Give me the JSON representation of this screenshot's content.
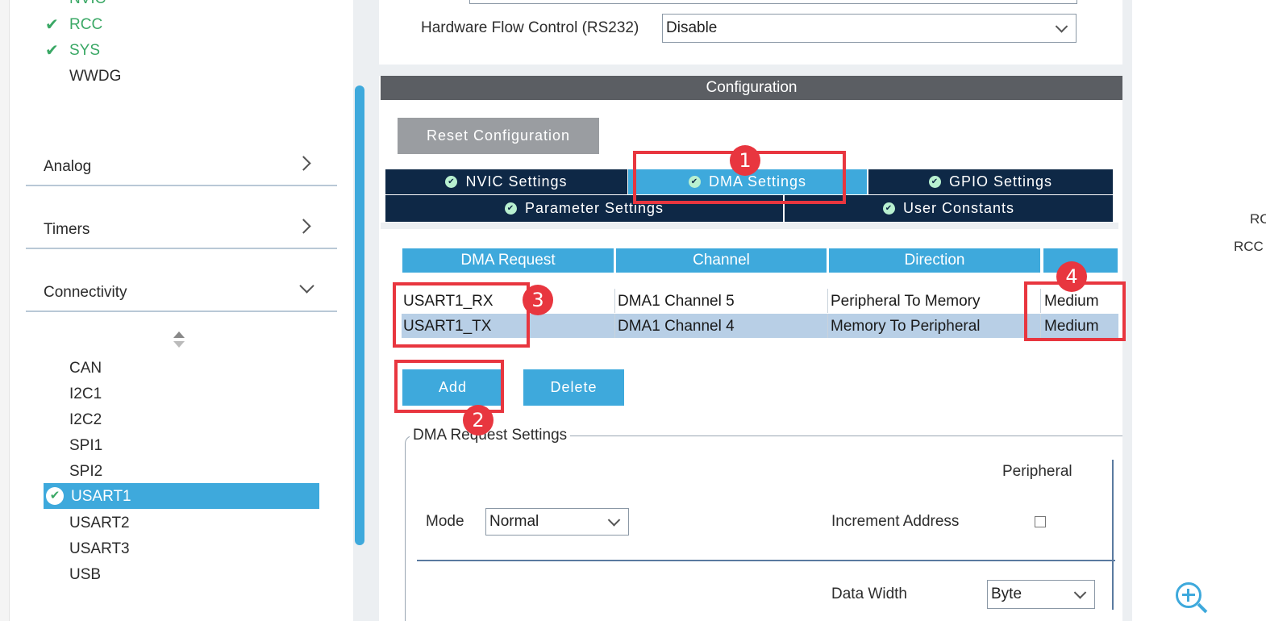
{
  "sidebar": {
    "partial_top": "NVIC",
    "system_items": [
      {
        "label": "RCC",
        "checked": true
      },
      {
        "label": "SYS",
        "checked": true
      },
      {
        "label": "WWDG",
        "checked": false
      }
    ],
    "categories": [
      {
        "label": "Analog",
        "chevron": "chevron-right-icon"
      },
      {
        "label": "Timers",
        "chevron": "chevron-right-icon"
      },
      {
        "label": "Connectivity",
        "chevron": "chevron-down-icon"
      }
    ],
    "connectivity_items": [
      "CAN",
      "I2C1",
      "I2C2",
      "SPI1",
      "SPI2",
      "USART1",
      "USART2",
      "USART3",
      "USB"
    ],
    "selected_item": "USART1"
  },
  "top_form": {
    "flow_control_label": "Hardware Flow Control (RS232)",
    "flow_control_value": "Disable"
  },
  "config": {
    "title": "Configuration",
    "reset_button": "Reset Configuration",
    "tabs_row1": [
      {
        "label": "NVIC Settings",
        "active": false
      },
      {
        "label": "DMA Settings",
        "active": true
      },
      {
        "label": "GPIO Settings",
        "active": false
      }
    ],
    "tabs_row2": [
      {
        "label": "Parameter Settings"
      },
      {
        "label": "User Constants"
      }
    ]
  },
  "dma_table": {
    "headers": [
      "DMA Request",
      "Channel",
      "Direction",
      ""
    ],
    "rows": [
      {
        "request": "USART1_RX",
        "channel": "DMA1 Channel 5",
        "direction": "Peripheral To Memory",
        "priority": "Medium",
        "selected": false
      },
      {
        "request": "USART1_TX",
        "channel": "DMA1 Channel 4",
        "direction": "Memory To Peripheral",
        "priority": "Medium",
        "selected": true
      }
    ],
    "add_button": "Add",
    "delete_button": "Delete"
  },
  "request_settings": {
    "legend": "DMA Request Settings",
    "peripheral_heading": "Peripheral",
    "mode_label": "Mode",
    "mode_value": "Normal",
    "increment_label": "Increment Address",
    "increment_checked": false,
    "data_width_label": "Data Width",
    "data_width_value": "Byte"
  },
  "annotations": [
    "1",
    "2",
    "3",
    "4"
  ],
  "right_panel": {
    "partial_lines": [
      "RC",
      "RCC"
    ]
  },
  "colors": {
    "accent": "#3ea9dc",
    "dark_tab": "#0e2846",
    "annotation_red": "#e8363f",
    "check_green": "#3aa865"
  }
}
